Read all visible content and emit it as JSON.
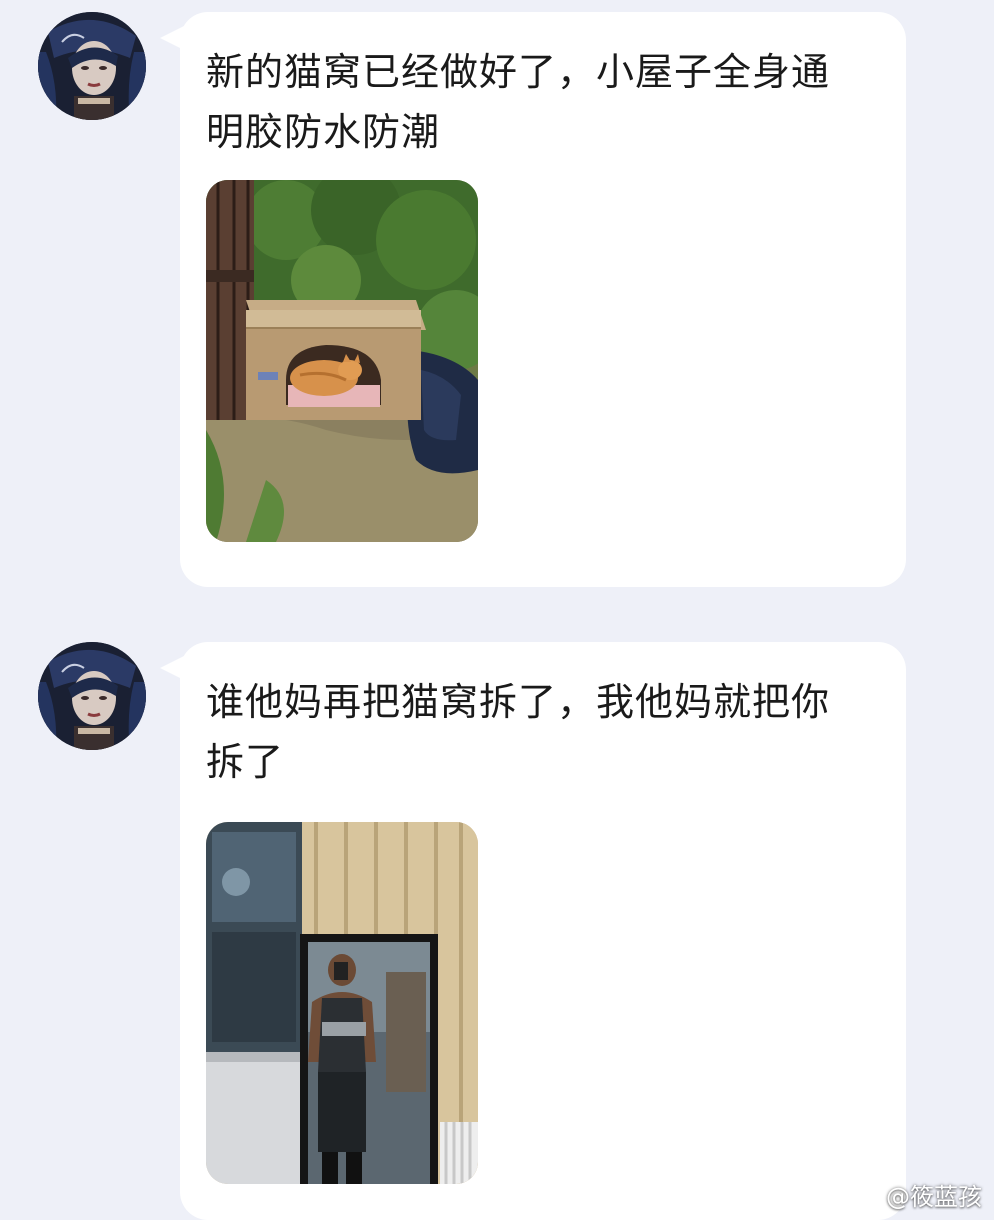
{
  "messages": [
    {
      "text": "新的猫窝已经做好了，小屋子全身通明胶防水防潮",
      "image": "photo-cardboard-cat-shelter"
    },
    {
      "text": "谁他妈再把猫窝拆了，我他妈就把你拆了",
      "image": "photo-mirror-selfie-muscular-man"
    }
  ],
  "watermark": {
    "icon": "weibo-icon",
    "text": "@筱蓝孩"
  },
  "colors": {
    "background": "#eef0f8",
    "bubble": "#ffffff",
    "text": "#1a1a1a"
  }
}
